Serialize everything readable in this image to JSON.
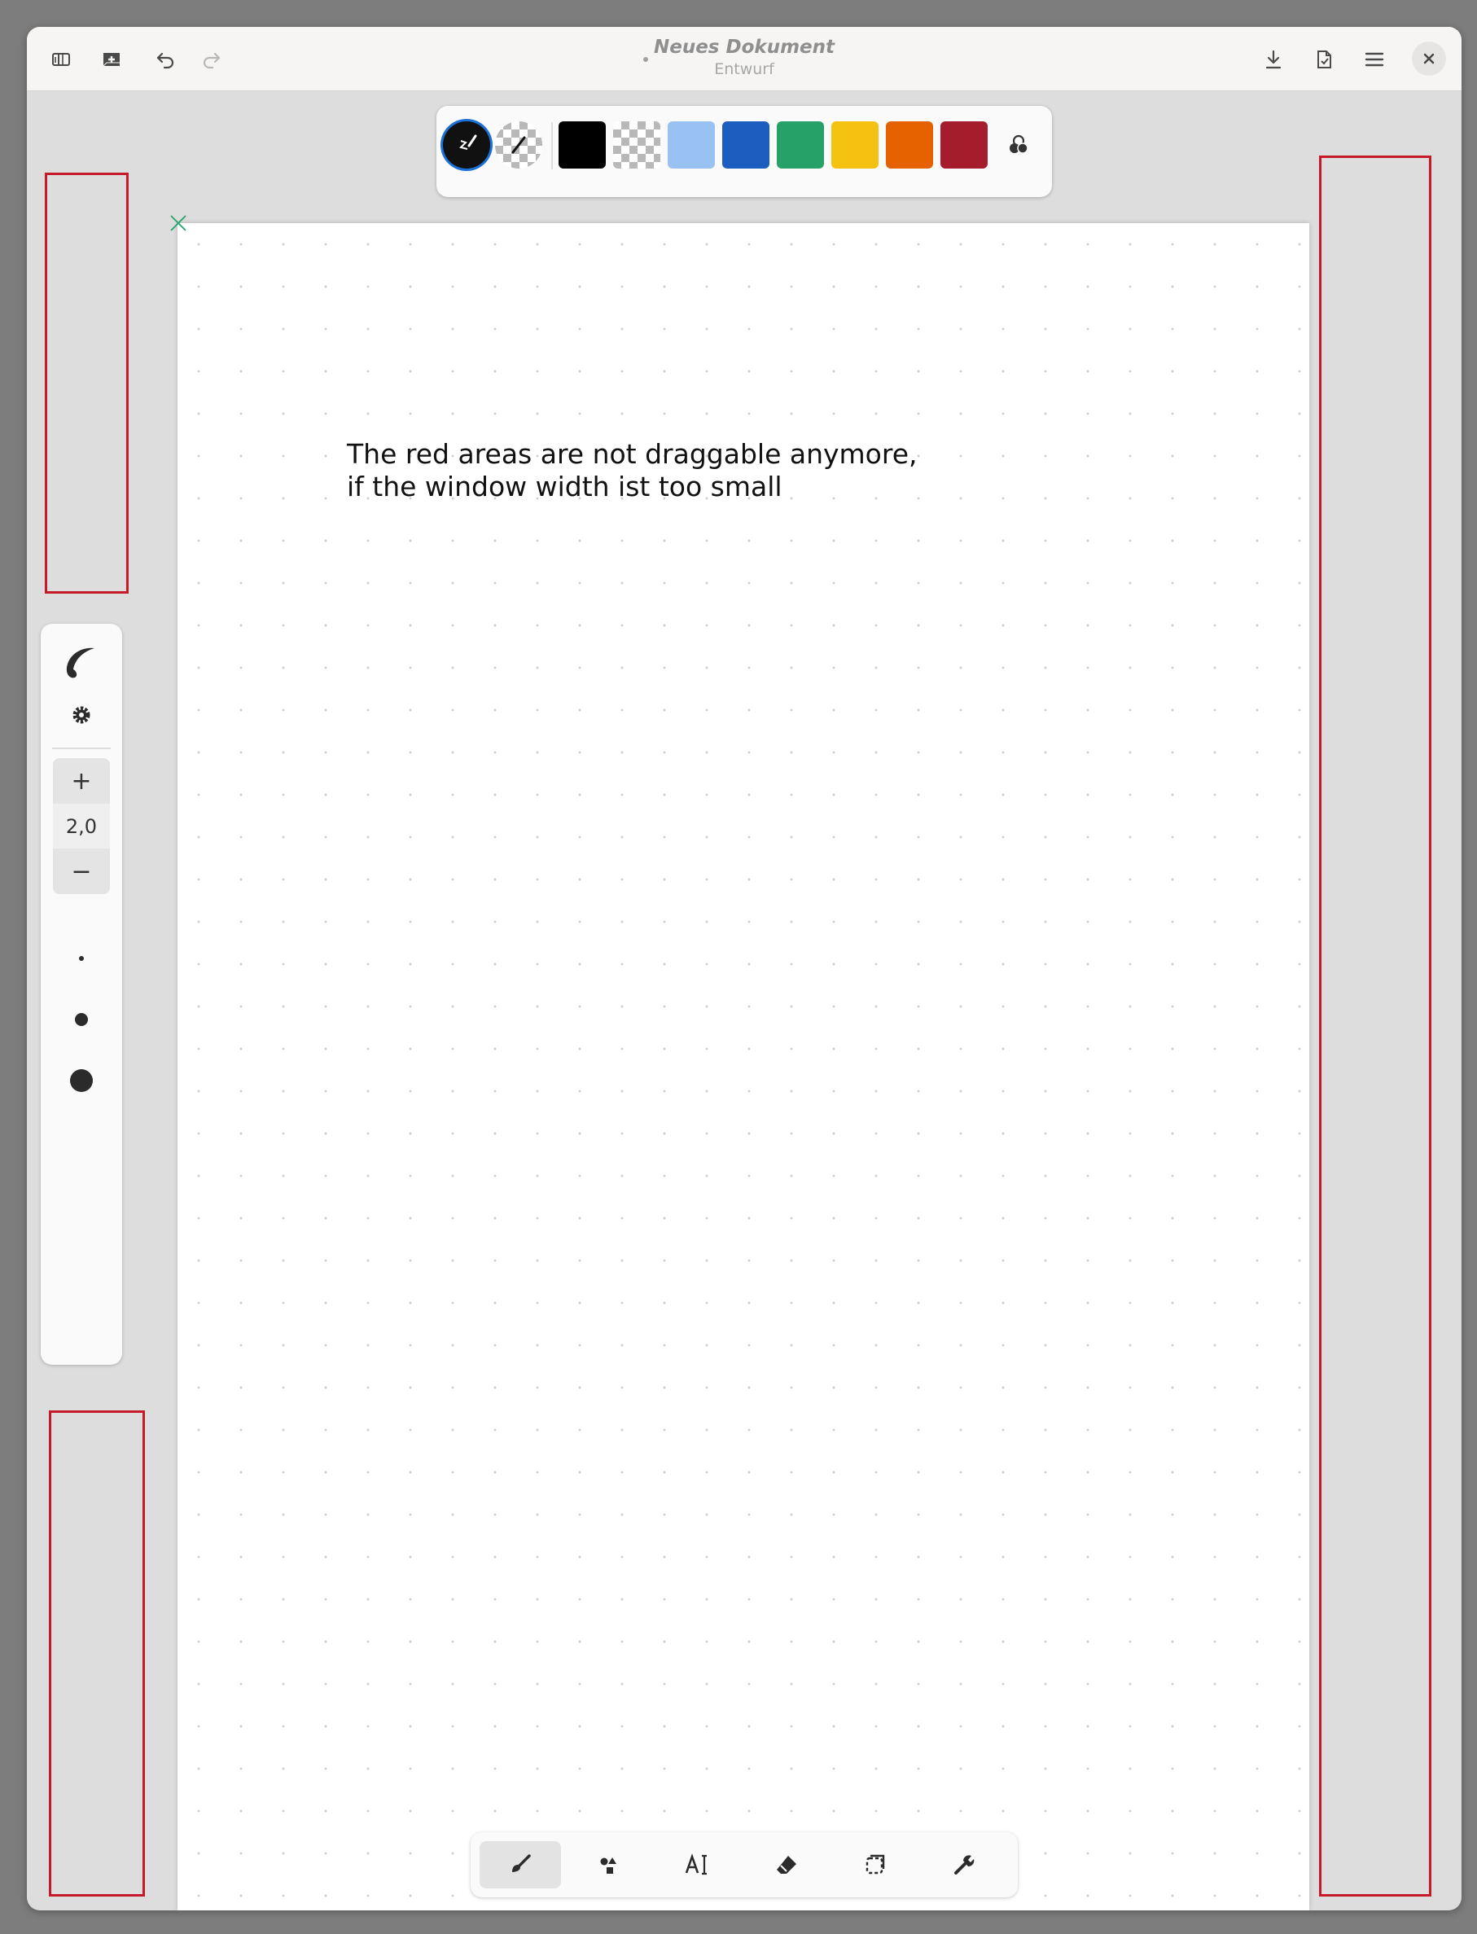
{
  "header": {
    "title": "Neues Dokument",
    "subtitle": "Entwurf",
    "buttons": {
      "sidebar": "sidebar-icon",
      "new_document": "new-document-icon",
      "undo": "undo-icon",
      "redo": "redo-icon",
      "export": "download-icon",
      "save_as": "document-save-icon",
      "menu": "hamburger-menu-icon",
      "close": "close-icon"
    }
  },
  "palette": {
    "modes": [
      "stroke-color-mode",
      "fill-color-mode"
    ],
    "colors": [
      "#000000",
      "transparent",
      "#99c1f1",
      "#1c5ebf",
      "#26a269",
      "#f5c211",
      "#e66100",
      "#a51d2d"
    ],
    "custom_color_icon": "color-picker-icon"
  },
  "canvas": {
    "text_lines": [
      "The red areas are not draggable anymore,",
      "if the window width ist too small"
    ],
    "annotation_color": "#c61a2a"
  },
  "pen_panel": {
    "style_icon": "brush-style-icon",
    "settings_icon": "gear-icon",
    "width_value": "2,0",
    "increase_label": "+",
    "decrease_label": "−",
    "width_presets": [
      "small-dot",
      "medium-dot",
      "large-dot"
    ]
  },
  "bottom_toolbar": {
    "tools": [
      "brush-icon",
      "shapes-icon",
      "text-tool-icon",
      "eraser-icon",
      "selector-icon",
      "wrench-icon"
    ],
    "active_tool": "brush-icon"
  }
}
